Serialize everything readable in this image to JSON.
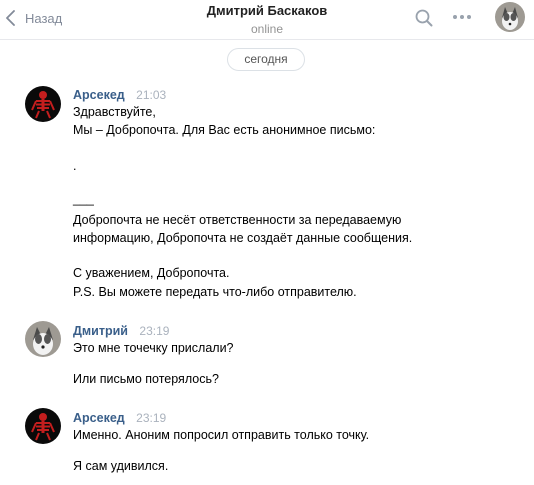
{
  "header": {
    "back_label": "Назад",
    "contact_name": "Дмитрий Баскаков",
    "contact_status": "online",
    "icons": [
      "back-chevron-icon",
      "search-icon",
      "more-dots-icon"
    ]
  },
  "date_separator": "сегодня",
  "messages": [
    {
      "author": "Арсекед",
      "time": "21:03",
      "lines": [
        "Здравствуйте,",
        "Мы – Добропочта. Для Вас есть анонимное письмо:",
        ".",
        "___",
        "Добропочта не несёт ответственности за передаваемую",
        "информацию, Добропочта не создаёт данные сообщения.",
        "С уважением, Добропочта.",
        "P.S. Вы можете передать что-либо отправителю."
      ]
    },
    {
      "author": "Дмитрий",
      "time": "23:19",
      "lines": [
        "Это мне точечку прислали?",
        "Или письмо потерялось?"
      ]
    },
    {
      "author": "Арсекед",
      "time": "23:19",
      "lines": [
        "Именно. Аноним попросил отправить только точку.",
        "Я сам удивился."
      ]
    }
  ],
  "colors": {
    "author_link": "#3a5f8a",
    "muted_text": "#828a99",
    "timestamp": "#aab2bd",
    "divider": "#e7e8ec"
  }
}
